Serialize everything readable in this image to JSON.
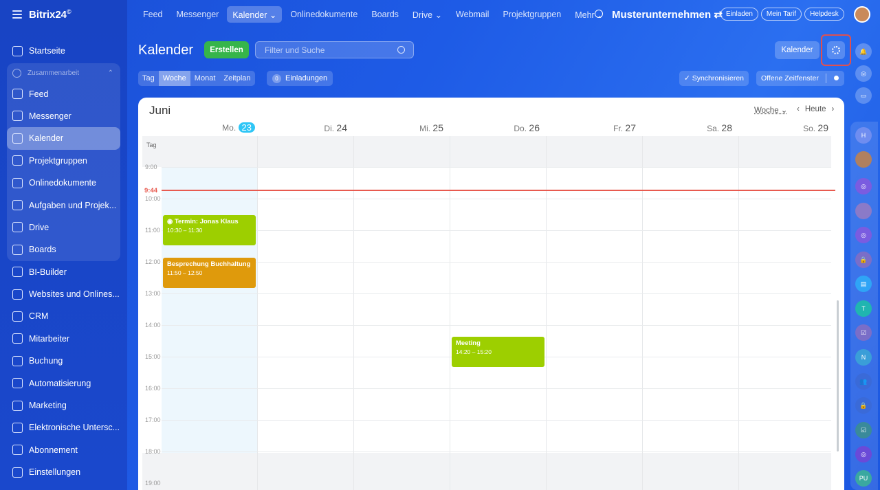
{
  "brand": {
    "name": "Bitrix24",
    "mark": "©"
  },
  "sidebar": {
    "items_top": [
      {
        "label": "Startseite",
        "icon": "home-icon"
      }
    ],
    "group": {
      "label": "Zusammenarbeit",
      "icon": "collab-icon"
    },
    "group_items": [
      {
        "label": "Feed",
        "icon": "feed-icon"
      },
      {
        "label": "Messenger",
        "icon": "chat-icon"
      },
      {
        "label": "Kalender",
        "icon": "calendar-icon"
      },
      {
        "label": "Projektgruppen",
        "icon": "groups-icon"
      },
      {
        "label": "Onlinedokumente",
        "icon": "document-icon"
      },
      {
        "label": "Aufgaben und Projek...",
        "icon": "tasks-icon"
      },
      {
        "label": "Drive",
        "icon": "drive-icon"
      },
      {
        "label": "Boards",
        "icon": "boards-icon"
      }
    ],
    "items_bottom": [
      {
        "label": "BI-Builder",
        "icon": "bi-icon"
      },
      {
        "label": "Websites und Onlines...",
        "icon": "cart-icon"
      },
      {
        "label": "CRM",
        "icon": "crm-icon"
      },
      {
        "label": "Mitarbeiter",
        "icon": "employees-icon"
      },
      {
        "label": "Buchung",
        "icon": "booking-icon"
      },
      {
        "label": "Automatisierung",
        "icon": "automation-icon"
      },
      {
        "label": "Marketing",
        "icon": "marketing-icon"
      },
      {
        "label": "Elektronische Untersc...",
        "icon": "signature-icon"
      },
      {
        "label": "Abonnement",
        "icon": "subscription-icon"
      },
      {
        "label": "Einstellungen",
        "icon": "settings-icon"
      }
    ]
  },
  "topbar": {
    "nav": [
      "Feed",
      "Messenger",
      "Kalender ⌄",
      "Onlinedokumente",
      "Boards",
      "Drive ⌄",
      "Webmail",
      "Projektgruppen",
      "Mehr ⌄"
    ],
    "company": "Musterunternehmen ⇄",
    "buttons": [
      "Einladen",
      "Mein Tarif",
      "Helpdesk"
    ]
  },
  "header": {
    "title": "Kalender",
    "create": "Erstellen",
    "filter_placeholder": "Filter und Suche",
    "calendar_btn": "Kalender"
  },
  "views": {
    "tabs": [
      "Tag",
      "Woche",
      "Monat",
      "Zeitplan"
    ],
    "active": "Woche"
  },
  "invites": {
    "count": "0",
    "label": "Einladungen"
  },
  "sync": "✓ Synchronisieren",
  "open_slots": "Offene Zeitfenster",
  "calendar": {
    "month": "Juni",
    "view_select": "Woche ⌄",
    "today": "Heute",
    "days": [
      {
        "name": "Mo.",
        "num": "23"
      },
      {
        "name": "Di.",
        "num": "24"
      },
      {
        "name": "Mi.",
        "num": "25"
      },
      {
        "name": "Do.",
        "num": "26"
      },
      {
        "name": "Fr.",
        "num": "27"
      },
      {
        "name": "Sa.",
        "num": "28"
      },
      {
        "name": "So.",
        "num": "29"
      }
    ],
    "allday_label": "Tag",
    "hours": [
      "9:00",
      "10:00",
      "11:00",
      "12:00",
      "13:00",
      "14:00",
      "15:00",
      "16:00",
      "17:00",
      "18:00",
      "19:00"
    ],
    "now": "9:44",
    "events": [
      {
        "title": "Termin: Jonas Klaus",
        "time": "10:30 – 11:30",
        "color": "#9dcf00",
        "day": 0
      },
      {
        "title": "Besprechung Buchhaltung",
        "time": "11:50 – 12:50",
        "color": "#df9a0c",
        "day": 0
      },
      {
        "title": "Meeting",
        "time": "14:20 – 15:20",
        "color": "#9dcf00",
        "day": 3
      }
    ]
  },
  "rail": {
    "items": [
      {
        "icon": "bell-icon"
      },
      {
        "icon": "copilot-icon"
      },
      {
        "icon": "chat-bubble-icon"
      },
      {
        "label": "H"
      },
      {
        "icon": "user-avatar"
      },
      {
        "icon": "copilot-icon"
      },
      {
        "icon": "user-avatar"
      },
      {
        "icon": "copilot-icon"
      },
      {
        "icon": "lock-icon"
      },
      {
        "icon": "chat-bubble-icon"
      },
      {
        "label": "T"
      },
      {
        "icon": "task-icon"
      },
      {
        "label": "N"
      },
      {
        "icon": "group-icon"
      },
      {
        "icon": "lock-icon"
      },
      {
        "icon": "task-icon"
      },
      {
        "icon": "copilot-icon"
      },
      {
        "label": "PU"
      }
    ]
  }
}
